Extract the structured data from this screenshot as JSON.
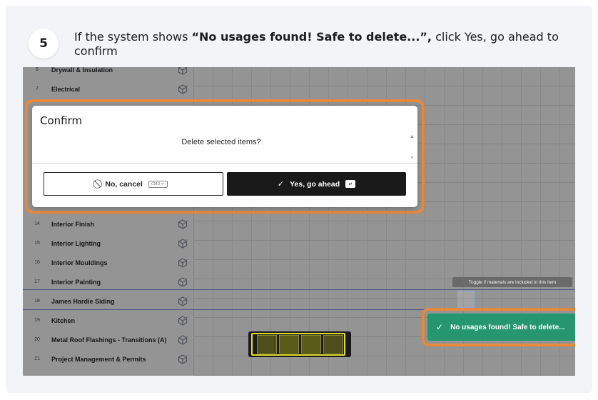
{
  "step": {
    "number": "5",
    "text_before": "If the system shows ",
    "text_bold": "“No usages found! Safe to delete...”,",
    "text_after": " click Yes, go ahead to confirm"
  },
  "list": {
    "rows": [
      {
        "num": "6",
        "name": "Drywall & Insulation"
      },
      {
        "num": "7",
        "name": "Electrical"
      },
      {
        "num": "14",
        "name": "Interior Finish"
      },
      {
        "num": "15",
        "name": "Interior Lighting"
      },
      {
        "num": "16",
        "name": "Interior Mouldings"
      },
      {
        "num": "17",
        "name": "Interior Painting"
      },
      {
        "num": "18",
        "name": "James Hardie Siding"
      },
      {
        "num": "19",
        "name": "Kitchen"
      },
      {
        "num": "20",
        "name": "Metal Roof Flashings - Transitions (A)"
      },
      {
        "num": "21",
        "name": "Project Management & Permits"
      }
    ]
  },
  "tooltip": {
    "text": "Toggle if materials are included in this item"
  },
  "dialog": {
    "title": "Confirm",
    "message": "Delete selected items?",
    "cancel_label": "No, cancel",
    "cancel_shortcut": "CMD ↵",
    "confirm_label": "Yes, go ahead",
    "confirm_shortcut": "↵"
  },
  "toast": {
    "message": "No usages found! Safe to delete..."
  },
  "colors": {
    "highlight": "#e8883a",
    "toast": "#25966f",
    "primary_button": "#1a1a1a",
    "selection_line": "#3b52c4"
  }
}
